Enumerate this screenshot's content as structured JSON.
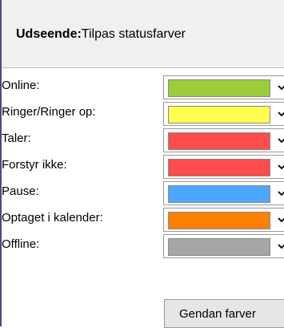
{
  "header": {
    "title_bold": "Udseende:",
    "title_rest": "Tilpas statusfarver"
  },
  "statuses": [
    {
      "label": "Online:",
      "color": "#9acd3a"
    },
    {
      "label": "Ringer/Ringer op:",
      "color": "#ffff4d"
    },
    {
      "label": "Taler:",
      "color": "#ff4c4c"
    },
    {
      "label": "Forstyr ikke:",
      "color": "#ff4c4c"
    },
    {
      "label": "Pause:",
      "color": "#4da6ff"
    },
    {
      "label": "Optaget i kalender:",
      "color": "#ff8000"
    },
    {
      "label": "Offline:",
      "color": "#a6a6a6"
    }
  ],
  "restore_button": {
    "label": "Gendan farver"
  },
  "icons": {
    "dropdown": "chevron-down-icon"
  }
}
